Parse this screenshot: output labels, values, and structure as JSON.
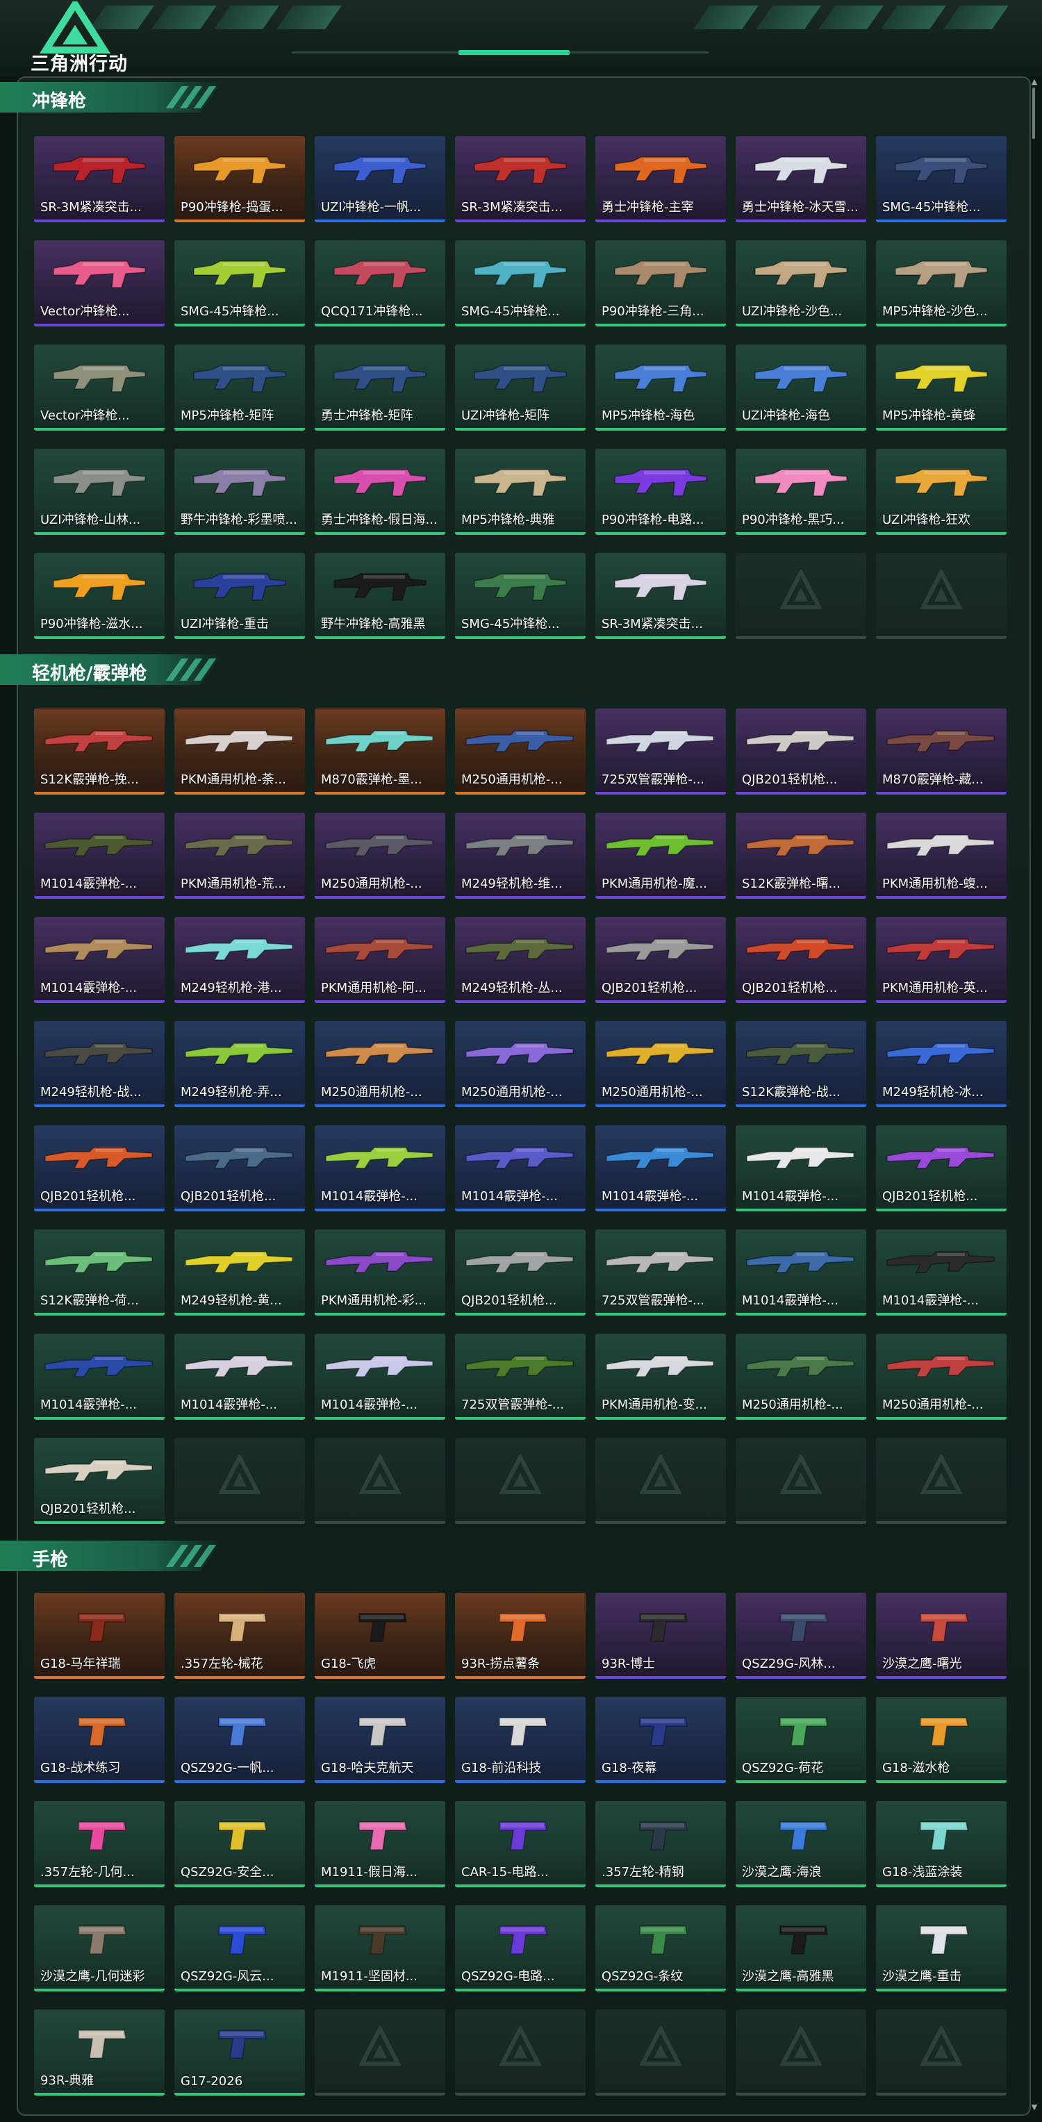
{
  "brand": {
    "logo_text": "三角洲行动"
  },
  "colors": {
    "gold": "#d8752a",
    "purple": "#6c46d8",
    "blue": "#2f6fe6",
    "green": "#34c77a",
    "accent": "#2fd39a"
  },
  "sections": [
    {
      "title": "冲锋枪",
      "items": [
        {
          "label": "SR-3M紧凑突击...",
          "rarity": "purple",
          "gun_color": "#b8232b"
        },
        {
          "label": "P90冲锋枪-捣蛋...",
          "rarity": "gold",
          "gun_color": "#e79a2a"
        },
        {
          "label": "UZI冲锋枪-一帆...",
          "rarity": "blue",
          "gun_color": "#3b5fd0"
        },
        {
          "label": "SR-3M紧凑突击...",
          "rarity": "purple",
          "gun_color": "#c0302a"
        },
        {
          "label": "勇士冲锋枪-主宰",
          "rarity": "purple",
          "gun_color": "#e0671f"
        },
        {
          "label": "勇士冲锋枪-冰天雪...",
          "rarity": "purple",
          "gun_color": "#d8dde6"
        },
        {
          "label": "SMG-45冲锋枪...",
          "rarity": "blue",
          "gun_color": "#3a4f7a"
        },
        {
          "label": "Vector冲锋枪...",
          "rarity": "purple",
          "gun_color": "#e85b8a"
        },
        {
          "label": "SMG-45冲锋枪...",
          "rarity": "green",
          "gun_color": "#a4cf34"
        },
        {
          "label": "QCQ171冲锋枪...",
          "rarity": "green",
          "gun_color": "#c44b5e"
        },
        {
          "label": "SMG-45冲锋枪...",
          "rarity": "green",
          "gun_color": "#4fb1c5"
        },
        {
          "label": "P90冲锋枪-三角...",
          "rarity": "green",
          "gun_color": "#a88a6a"
        },
        {
          "label": "UZI冲锋枪-沙色...",
          "rarity": "green",
          "gun_color": "#c2a882"
        },
        {
          "label": "MP5冲锋枪-沙色...",
          "rarity": "green",
          "gun_color": "#b59f82"
        },
        {
          "label": "Vector冲锋枪...",
          "rarity": "green",
          "gun_color": "#8f927a"
        },
        {
          "label": "MP5冲锋枪-矩阵",
          "rarity": "green",
          "gun_color": "#2f4f86"
        },
        {
          "label": "勇士冲锋枪-矩阵",
          "rarity": "green",
          "gun_color": "#2f4f86"
        },
        {
          "label": "UZI冲锋枪-矩阵",
          "rarity": "green",
          "gun_color": "#2f4f86"
        },
        {
          "label": "MP5冲锋枪-海色",
          "rarity": "green",
          "gun_color": "#4a7fd8"
        },
        {
          "label": "UZI冲锋枪-海色",
          "rarity": "green",
          "gun_color": "#4a7fd8"
        },
        {
          "label": "MP5冲锋枪-黄蜂",
          "rarity": "green",
          "gun_color": "#e3d22a"
        },
        {
          "label": "UZI冲锋枪-山林...",
          "rarity": "green",
          "gun_color": "#8a9088"
        },
        {
          "label": "野牛冲锋枪-彩墨喷...",
          "rarity": "green",
          "gun_color": "#8a7fa6"
        },
        {
          "label": "勇士冲锋枪-假日海...",
          "rarity": "green",
          "gun_color": "#d94fb0"
        },
        {
          "label": "MP5冲锋枪-典雅",
          "rarity": "green",
          "gun_color": "#c9b58e"
        },
        {
          "label": "P90冲锋枪-电路...",
          "rarity": "green",
          "gun_color": "#7a3ae0"
        },
        {
          "label": "P90冲锋枪-黑巧...",
          "rarity": "green",
          "gun_color": "#f08cc0"
        },
        {
          "label": "UZI冲锋枪-狂欢",
          "rarity": "green",
          "gun_color": "#e8a83a"
        },
        {
          "label": "P90冲锋枪-滋水...",
          "rarity": "green",
          "gun_color": "#f0a020"
        },
        {
          "label": "UZI冲锋枪-重击",
          "rarity": "green",
          "gun_color": "#2a3f9a"
        },
        {
          "label": "野牛冲锋枪-高雅黑",
          "rarity": "green",
          "gun_color": "#1a1a1a"
        },
        {
          "label": "SMG-45冲锋枪...",
          "rarity": "green",
          "gun_color": "#3b7d4a"
        },
        {
          "label": "SR-3M紧凑突击...",
          "rarity": "green",
          "gun_color": "#d8d4e6"
        },
        {
          "label": "",
          "rarity": "empty",
          "gun_color": ""
        },
        {
          "label": "",
          "rarity": "empty",
          "gun_color": ""
        }
      ]
    },
    {
      "title": "轻机枪/霰弹枪",
      "items": [
        {
          "label": "S12K霰弹枪-挽...",
          "rarity": "gold",
          "gun_color": "#c24040"
        },
        {
          "label": "PKM通用机枪-荼...",
          "rarity": "gold",
          "gun_color": "#d8d0cc"
        },
        {
          "label": "M870霰弹枪-墨...",
          "rarity": "gold",
          "gun_color": "#6fd2c8"
        },
        {
          "label": "M250通用机枪-...",
          "rarity": "gold",
          "gun_color": "#3a5da8"
        },
        {
          "label": "725双管霰弹枪-...",
          "rarity": "purple",
          "gun_color": "#cfd6e2"
        },
        {
          "label": "QJB201轻机枪...",
          "rarity": "purple",
          "gun_color": "#cfcac6"
        },
        {
          "label": "M870霰弹枪-藏...",
          "rarity": "purple",
          "gun_color": "#7a4a42"
        },
        {
          "label": "M1014霰弹枪-...",
          "rarity": "purple",
          "gun_color": "#4a5a2e"
        },
        {
          "label": "PKM通用机枪-荒...",
          "rarity": "purple",
          "gun_color": "#6a6a4a"
        },
        {
          "label": "M250通用机枪-...",
          "rarity": "purple",
          "gun_color": "#5a5a66"
        },
        {
          "label": "M249轻机枪-维...",
          "rarity": "purple",
          "gun_color": "#7a8082"
        },
        {
          "label": "PKM通用机枪-魔...",
          "rarity": "purple",
          "gun_color": "#6fc030"
        },
        {
          "label": "S12K霰弹枪-曙...",
          "rarity": "purple",
          "gun_color": "#c06a3a"
        },
        {
          "label": "PKM通用机枪-蝮...",
          "rarity": "purple",
          "gun_color": "#d8d8d8"
        },
        {
          "label": "M1014霰弹枪-...",
          "rarity": "purple",
          "gun_color": "#b08a5a"
        },
        {
          "label": "M249轻机枪-港...",
          "rarity": "purple",
          "gun_color": "#7ad8d8"
        },
        {
          "label": "PKM通用机枪-阿...",
          "rarity": "purple",
          "gun_color": "#a84a3a"
        },
        {
          "label": "M249轻机枪-丛...",
          "rarity": "purple",
          "gun_color": "#5a6a3a"
        },
        {
          "label": "QJB201轻机枪...",
          "rarity": "purple",
          "gun_color": "#9a9a9a"
        },
        {
          "label": "QJB201轻机枪...",
          "rarity": "purple",
          "gun_color": "#d04a2a"
        },
        {
          "label": "PKM通用机枪-英...",
          "rarity": "purple",
          "gun_color": "#c03a3a"
        },
        {
          "label": "M249轻机枪-战...",
          "rarity": "blue",
          "gun_color": "#4a4a42"
        },
        {
          "label": "M249轻机枪-弄...",
          "rarity": "blue",
          "gun_color": "#8ac83a"
        },
        {
          "label": "M250通用机枪-...",
          "rarity": "blue",
          "gun_color": "#d08a4a"
        },
        {
          "label": "M250通用机枪-...",
          "rarity": "blue",
          "gun_color": "#8a6ad8"
        },
        {
          "label": "M250通用机枪-...",
          "rarity": "blue",
          "gun_color": "#e0b02a"
        },
        {
          "label": "S12K霰弹枪-战...",
          "rarity": "blue",
          "gun_color": "#4a5a3a"
        },
        {
          "label": "M249轻机枪-冰...",
          "rarity": "blue",
          "gun_color": "#3a6ad8"
        },
        {
          "label": "QJB201轻机枪...",
          "rarity": "blue",
          "gun_color": "#d85a2a"
        },
        {
          "label": "QJB201轻机枪...",
          "rarity": "blue",
          "gun_color": "#4a6a8a"
        },
        {
          "label": "M1014霰弹枪-...",
          "rarity": "blue",
          "gun_color": "#9ad040"
        },
        {
          "label": "M1014霰弹枪-...",
          "rarity": "blue",
          "gun_color": "#5a5ac8"
        },
        {
          "label": "M1014霰弹枪-...",
          "rarity": "blue",
          "gun_color": "#3a8ad8"
        },
        {
          "label": "M1014霰弹枪-...",
          "rarity": "green",
          "gun_color": "#e8e8ea"
        },
        {
          "label": "QJB201轻机枪...",
          "rarity": "green",
          "gun_color": "#9a4ad8"
        },
        {
          "label": "S12K霰弹枪-荷...",
          "rarity": "green",
          "gun_color": "#6ac07a"
        },
        {
          "label": "M249轻机枪-黄...",
          "rarity": "green",
          "gun_color": "#e0d02a"
        },
        {
          "label": "PKM通用机枪-彩...",
          "rarity": "green",
          "gun_color": "#8a4ac8"
        },
        {
          "label": "QJB201轻机枪...",
          "rarity": "green",
          "gun_color": "#a0a4a4"
        },
        {
          "label": "725双管霰弹枪-...",
          "rarity": "green",
          "gun_color": "#b8b8b8"
        },
        {
          "label": "M1014霰弹枪-...",
          "rarity": "green",
          "gun_color": "#3a6aa8"
        },
        {
          "label": "M1014霰弹枪-...",
          "rarity": "green",
          "gun_color": "#2a2a2a"
        },
        {
          "label": "M1014霰弹枪-...",
          "rarity": "green",
          "gun_color": "#2a4aa8"
        },
        {
          "label": "M1014霰弹枪-...",
          "rarity": "green",
          "gun_color": "#d8d0e0"
        },
        {
          "label": "M1014霰弹枪-...",
          "rarity": "green",
          "gun_color": "#c8c8e8"
        },
        {
          "label": "725双管霰弹枪-...",
          "rarity": "green",
          "gun_color": "#4a7a2a"
        },
        {
          "label": "PKM通用机枪-变...",
          "rarity": "green",
          "gun_color": "#d8d8e0"
        },
        {
          "label": "M250通用机枪-...",
          "rarity": "green",
          "gun_color": "#4a7a4a"
        },
        {
          "label": "M250通用机枪-...",
          "rarity": "green",
          "gun_color": "#c04040"
        },
        {
          "label": "QJB201轻机枪...",
          "rarity": "green",
          "gun_color": "#d8d0c0"
        },
        {
          "label": "",
          "rarity": "empty",
          "gun_color": ""
        },
        {
          "label": "",
          "rarity": "empty",
          "gun_color": ""
        },
        {
          "label": "",
          "rarity": "empty",
          "gun_color": ""
        },
        {
          "label": "",
          "rarity": "empty",
          "gun_color": ""
        },
        {
          "label": "",
          "rarity": "empty",
          "gun_color": ""
        },
        {
          "label": "",
          "rarity": "empty",
          "gun_color": ""
        }
      ]
    },
    {
      "title": "手枪",
      "items": [
        {
          "label": "G18-马年祥瑞",
          "rarity": "gold",
          "gun_color": "#8a2a1a"
        },
        {
          "label": ".357左轮-械花",
          "rarity": "gold",
          "gun_color": "#d8b07a"
        },
        {
          "label": "G18-飞虎",
          "rarity": "gold",
          "gun_color": "#1a1a1a"
        },
        {
          "label": "93R-捞点薯条",
          "rarity": "gold",
          "gun_color": "#e06a2a"
        },
        {
          "label": "93R-博士",
          "rarity": "purple",
          "gun_color": "#2a2a2a"
        },
        {
          "label": "QSZ29G-风林...",
          "rarity": "purple",
          "gun_color": "#3a4a6a"
        },
        {
          "label": "沙漠之鹰-曙光",
          "rarity": "purple",
          "gun_color": "#c84a3a"
        },
        {
          "label": "G18-战术练习",
          "rarity": "blue",
          "gun_color": "#d86a2a"
        },
        {
          "label": "QSZ92G-一帆...",
          "rarity": "blue",
          "gun_color": "#4a7ad8"
        },
        {
          "label": "G18-哈夫克航天",
          "rarity": "blue",
          "gun_color": "#c8c8c8"
        },
        {
          "label": "G18-前沿科技",
          "rarity": "blue",
          "gun_color": "#d8d8d8"
        },
        {
          "label": "G18-夜幕",
          "rarity": "blue",
          "gun_color": "#2a3a8a"
        },
        {
          "label": "QSZ92G-荷花",
          "rarity": "green",
          "gun_color": "#4aa85a"
        },
        {
          "label": "G18-滋水枪",
          "rarity": "green",
          "gun_color": "#e89a2a"
        },
        {
          "label": ".357左轮-几何...",
          "rarity": "green",
          "gun_color": "#e84aa0"
        },
        {
          "label": "QSZ92G-安全...",
          "rarity": "green",
          "gun_color": "#e0c02a"
        },
        {
          "label": "M1911-假日海...",
          "rarity": "green",
          "gun_color": "#e86ab0"
        },
        {
          "label": "CAR-15-电路...",
          "rarity": "green",
          "gun_color": "#6a3ad8"
        },
        {
          "label": ".357左轮-精钢",
          "rarity": "green",
          "gun_color": "#2a3a4a"
        },
        {
          "label": "沙漠之鹰-海浪",
          "rarity": "green",
          "gun_color": "#3a7ad8"
        },
        {
          "label": "G18-浅蓝涂装",
          "rarity": "green",
          "gun_color": "#7ad8d0"
        },
        {
          "label": "沙漠之鹰-几何迷彩",
          "rarity": "green",
          "gun_color": "#8a7a6a"
        },
        {
          "label": "QSZ92G-风云...",
          "rarity": "green",
          "gun_color": "#2a4ad8"
        },
        {
          "label": "M1911-坚固材...",
          "rarity": "green",
          "gun_color": "#4a3a2a"
        },
        {
          "label": "QSZ92G-电路...",
          "rarity": "green",
          "gun_color": "#6a3ad8"
        },
        {
          "label": "QSZ92G-条纹",
          "rarity": "green",
          "gun_color": "#3a8a4a"
        },
        {
          "label": "沙漠之鹰-高雅黑",
          "rarity": "green",
          "gun_color": "#1a1a1a"
        },
        {
          "label": "沙漠之鹰-重击",
          "rarity": "green",
          "gun_color": "#e0e0e8"
        },
        {
          "label": "93R-典雅",
          "rarity": "green",
          "gun_color": "#c8c0b0"
        },
        {
          "label": "G17-2026",
          "rarity": "green",
          "gun_color": "#2a3a8a"
        },
        {
          "label": "",
          "rarity": "empty",
          "gun_color": ""
        },
        {
          "label": "",
          "rarity": "empty",
          "gun_color": ""
        },
        {
          "label": "",
          "rarity": "empty",
          "gun_color": ""
        },
        {
          "label": "",
          "rarity": "empty",
          "gun_color": ""
        },
        {
          "label": "",
          "rarity": "empty",
          "gun_color": ""
        }
      ]
    }
  ]
}
